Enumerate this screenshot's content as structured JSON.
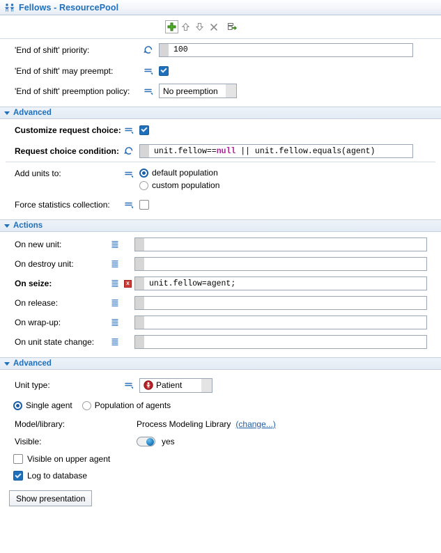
{
  "window": {
    "title": "Fellows - ResourcePool",
    "icon": "resource-pool-icon",
    "title_color": "#1f6fba"
  },
  "toolbar": {
    "buttons": [
      {
        "name": "add-button",
        "icon": "green-plus-icon",
        "label": "Add"
      },
      {
        "name": "move-up-button",
        "icon": "arrow-up-icon",
        "label": "Move up"
      },
      {
        "name": "move-down-button",
        "icon": "arrow-down-icon",
        "label": "Move down"
      },
      {
        "name": "delete-button",
        "icon": "close-x-icon",
        "label": "Delete"
      },
      {
        "name": "export-button",
        "icon": "export-arrow-icon",
        "label": "Export"
      }
    ]
  },
  "top_properties": [
    {
      "label": "'End of shift' priority:",
      "mode_icon": "dynamic-value-icon",
      "control": "textfield",
      "value": "100"
    },
    {
      "label": "'End of shift' may preempt:",
      "mode_icon": "static-value-icon",
      "control": "checkbox",
      "checked": true
    },
    {
      "label": "'End of shift' preemption policy:",
      "mode_icon": "static-value-icon",
      "control": "combo",
      "value": "No preemption"
    }
  ],
  "advanced_section": {
    "title": "Advanced",
    "expanded": true,
    "rows": [
      {
        "label": "Customize request choice:",
        "mode_icon": "static-value-icon",
        "control": "checkbox",
        "checked": true,
        "bold": true
      },
      {
        "label": "Request choice condition:",
        "mode_icon": "dynamic-value-icon",
        "control": "code",
        "bold": true,
        "code_parts": [
          {
            "text": "unit.fellow==",
            "type": "plain"
          },
          {
            "text": "null",
            "type": "keyword"
          },
          {
            "text": " || unit.fellow.equals(agent)",
            "type": "plain"
          }
        ]
      }
    ],
    "add_units_to": {
      "label": "Add units to:",
      "mode_icon": "static-value-icon",
      "options": [
        {
          "label": "default population",
          "selected": true
        },
        {
          "label": "custom population",
          "selected": false
        }
      ]
    },
    "force_statistics": {
      "label": "Force statistics collection:",
      "mode_icon": "static-value-icon",
      "checked": false
    }
  },
  "actions_section": {
    "title": "Actions",
    "expanded": true,
    "rows": [
      {
        "label": "On new unit:",
        "icon": "code-editor-icon",
        "value": "",
        "bold": false,
        "error": false
      },
      {
        "label": "On destroy unit:",
        "icon": "code-editor-icon",
        "value": "",
        "bold": false,
        "error": false
      },
      {
        "label": "On seize:",
        "icon": "code-editor-icon",
        "value": "unit.fellow=agent;",
        "bold": true,
        "error": true,
        "error_icon": "error-marker-icon"
      },
      {
        "label": "On release:",
        "icon": "code-editor-icon",
        "value": "",
        "bold": false,
        "error": false
      },
      {
        "label": "On wrap-up:",
        "icon": "code-editor-icon",
        "value": "",
        "bold": false,
        "error": false
      },
      {
        "label": "On unit state change:",
        "icon": "code-editor-icon",
        "value": "",
        "bold": false,
        "error": false
      }
    ]
  },
  "advanced_section2": {
    "title": "Advanced",
    "expanded": true,
    "unit_type": {
      "label": "Unit type:",
      "mode_icon": "static-value-icon",
      "value": "Patient",
      "value_icon": "agent-type-icon",
      "value_icon_color": "#b52025"
    },
    "agent_scope": {
      "options": [
        {
          "label": "Single agent",
          "selected": true
        },
        {
          "label": "Population of agents",
          "selected": false
        }
      ]
    },
    "model_library": {
      "label": "Model/library:",
      "value": "Process Modeling Library",
      "link": "(change...)"
    },
    "visible": {
      "label": "Visible:",
      "toggle_on": true,
      "value": "yes"
    },
    "visible_on_upper_agent": {
      "label": "Visible on upper agent",
      "checked": false
    },
    "log_to_database": {
      "label": "Log to database",
      "checked": true
    },
    "show_presentation_button": "Show presentation"
  }
}
